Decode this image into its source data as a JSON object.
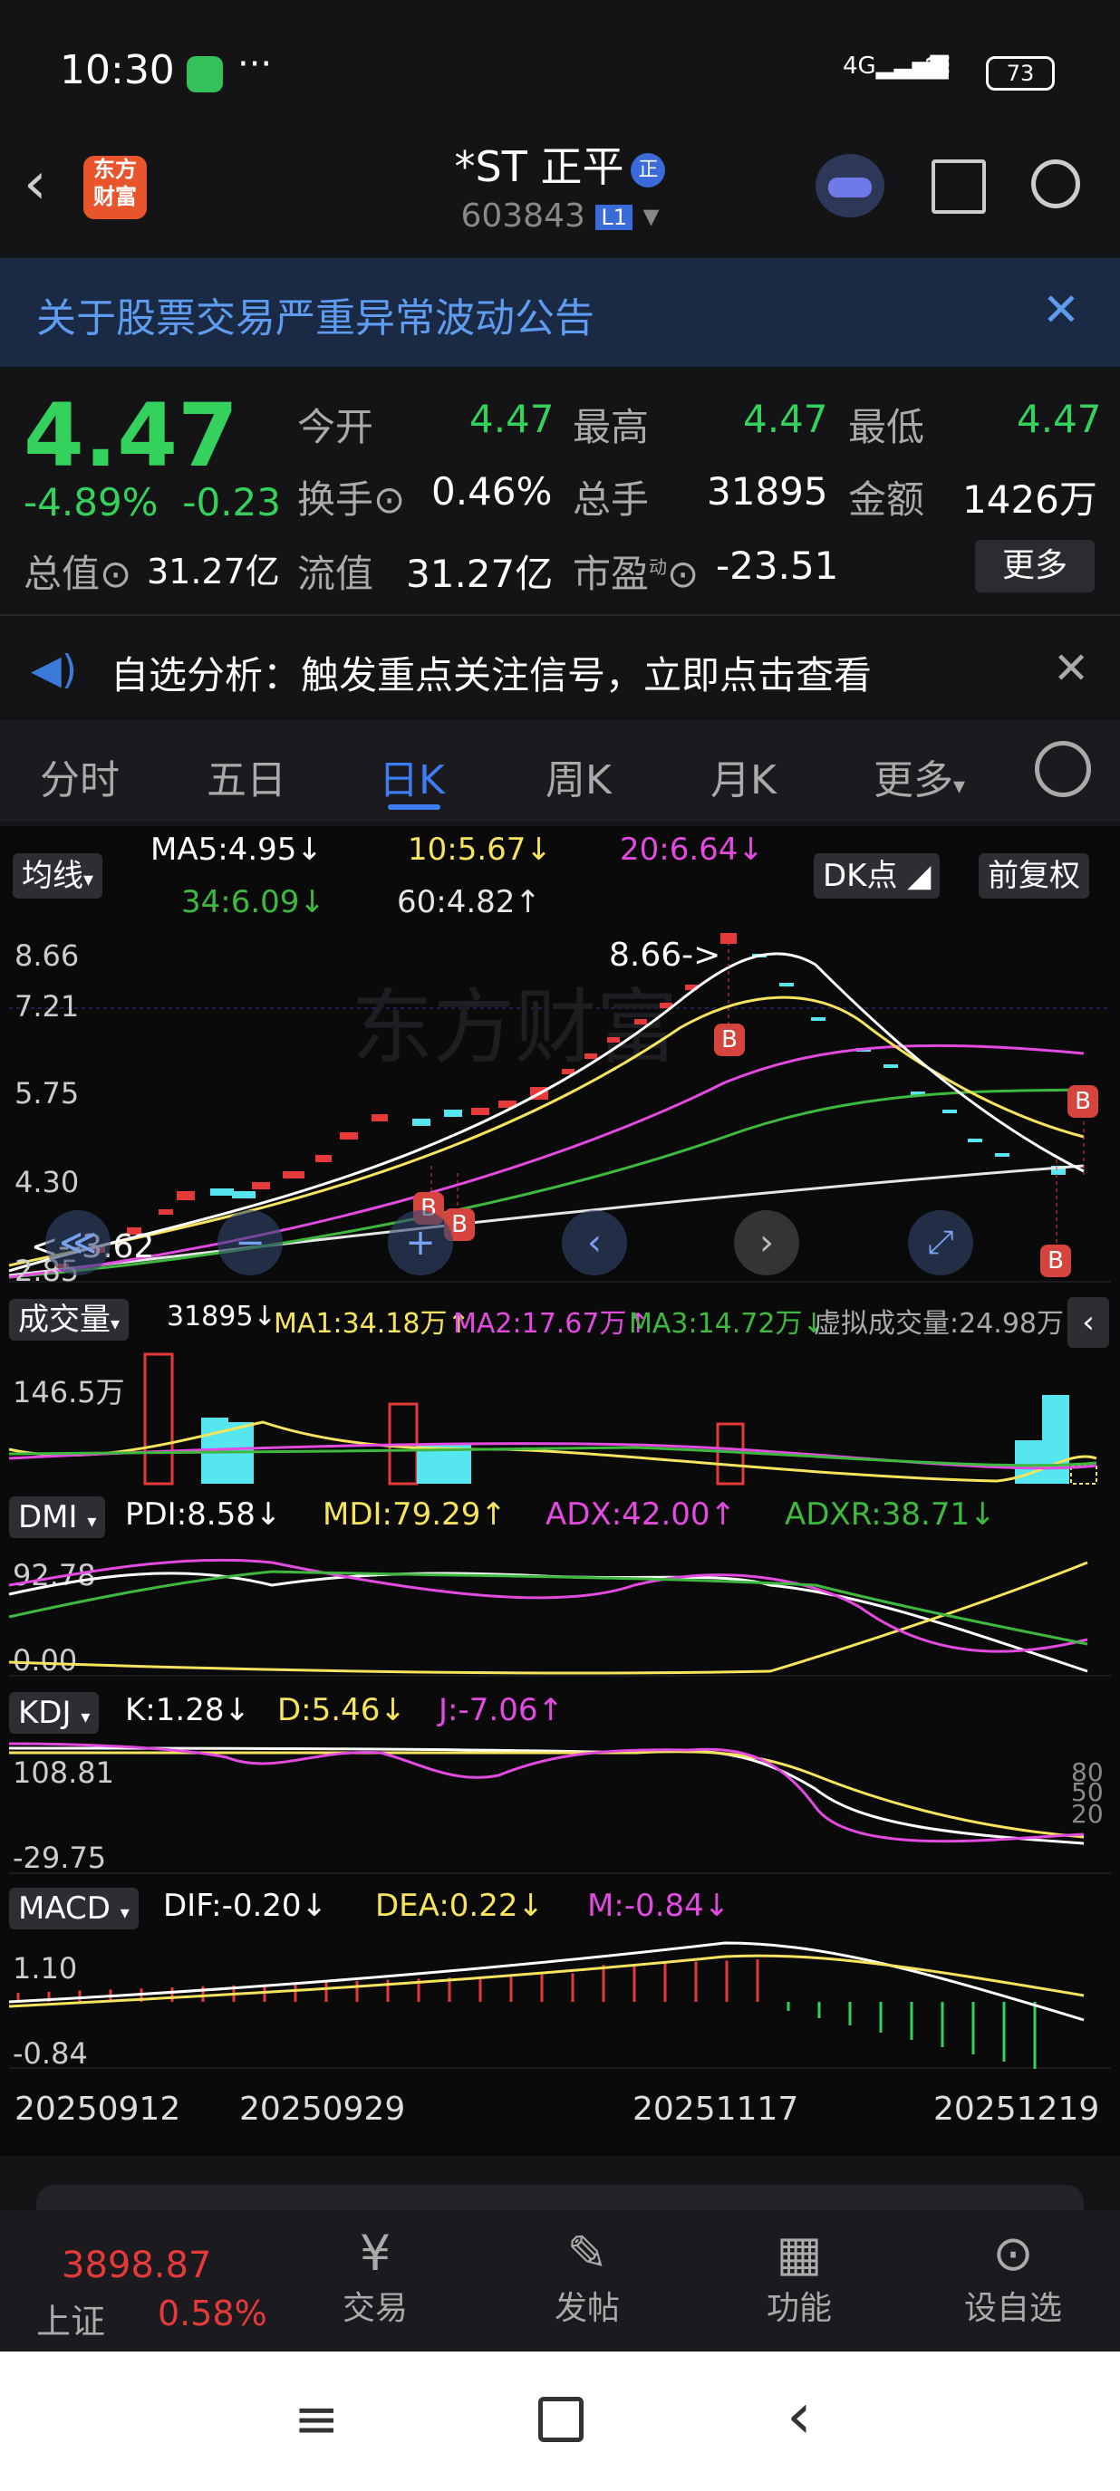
{
  "status_bar": {
    "time": "10:30",
    "signal": "4G",
    "battery": "73"
  },
  "header": {
    "title": "*ST 正平",
    "badge": "正",
    "code": "603843",
    "level": "L1",
    "logo_text": "东方财富"
  },
  "notice": {
    "text": "关于股票交易严重异常波动公告"
  },
  "quote": {
    "price": "4.47",
    "change_pct": "-4.89%",
    "change": "-0.23",
    "open_label": "今开",
    "open": "4.47",
    "high_label": "最高",
    "high": "4.47",
    "low_label": "最低",
    "low": "4.47",
    "turnover_label": "换手",
    "turnover": "0.46%",
    "volume_label": "总手",
    "volume": "31895",
    "amount_label": "金额",
    "amount": "1426万",
    "mktcap_label": "总值",
    "mktcap": "31.27亿",
    "float_label": "流值",
    "float_cap": "31.27亿",
    "pe_label": "市盈",
    "pe_sup": "动",
    "pe": "-23.51",
    "more": "更多"
  },
  "alert": {
    "text": "自选分析：触发重点关注信号，立即点击查看"
  },
  "tabs": [
    "分时",
    "五日",
    "日K",
    "周K",
    "月K",
    "更多"
  ],
  "active_tab": "日K",
  "chart_controls": {
    "ma_toggle": "均线",
    "dk": "DK点",
    "adjust": "前复权"
  },
  "ma": {
    "ma5": "MA5:4.95",
    "ma10": "10:5.67",
    "ma20": "20:6.64",
    "ma34": "34:6.09",
    "ma60": "60:4.82"
  },
  "price_axis": [
    "8.66",
    "7.21",
    "5.75",
    "4.30",
    "2.85"
  ],
  "markers": {
    "high_label": "8.66->",
    "low_label": "<--3.62",
    "buy": "B"
  },
  "volume_panel": {
    "selector": "成交量",
    "vol": "31895",
    "ma1": "MA1:34.18万",
    "ma2": "MA2:17.67万",
    "ma3": "MA3:14.72万",
    "virtual": "虚拟成交量:24.98万",
    "axis": "146.5万"
  },
  "dmi_panel": {
    "selector": "DMI",
    "pdi": "PDI:8.58",
    "mdi": "MDI:79.29",
    "adx": "ADX:42.00",
    "adxr": "ADXR:38.71",
    "axis_top": "92.78",
    "axis_bottom": "0.00"
  },
  "kdj_panel": {
    "selector": "KDJ",
    "k": "K:1.28",
    "d": "D:5.46",
    "j": "J:-7.06",
    "axis_top": "108.81",
    "axis_bottom": "-29.75",
    "levels": [
      "80",
      "50",
      "20"
    ]
  },
  "macd_panel": {
    "selector": "MACD",
    "dif": "DIF:-0.20",
    "dea": "DEA:0.22",
    "m": "M:-0.84",
    "axis_top": "1.10",
    "axis_bottom": "-0.84"
  },
  "dates": [
    "20250912",
    "20250929",
    "20251117",
    "20251219"
  ],
  "bottom_bar": {
    "index_name": "上证",
    "index_value": "3898.87",
    "index_change": "0.58%",
    "trade": "交易",
    "post": "发帖",
    "functions": "功能",
    "watchlist": "设自选"
  },
  "colors": {
    "up": "#e63a3a",
    "down": "#34d15c",
    "accent": "#3d7df0",
    "ma5": "#ffffff",
    "ma10": "#f6e45c",
    "ma20": "#e24ae0",
    "ma34": "#3fb83f",
    "ma60": "#e6e6e6"
  }
}
